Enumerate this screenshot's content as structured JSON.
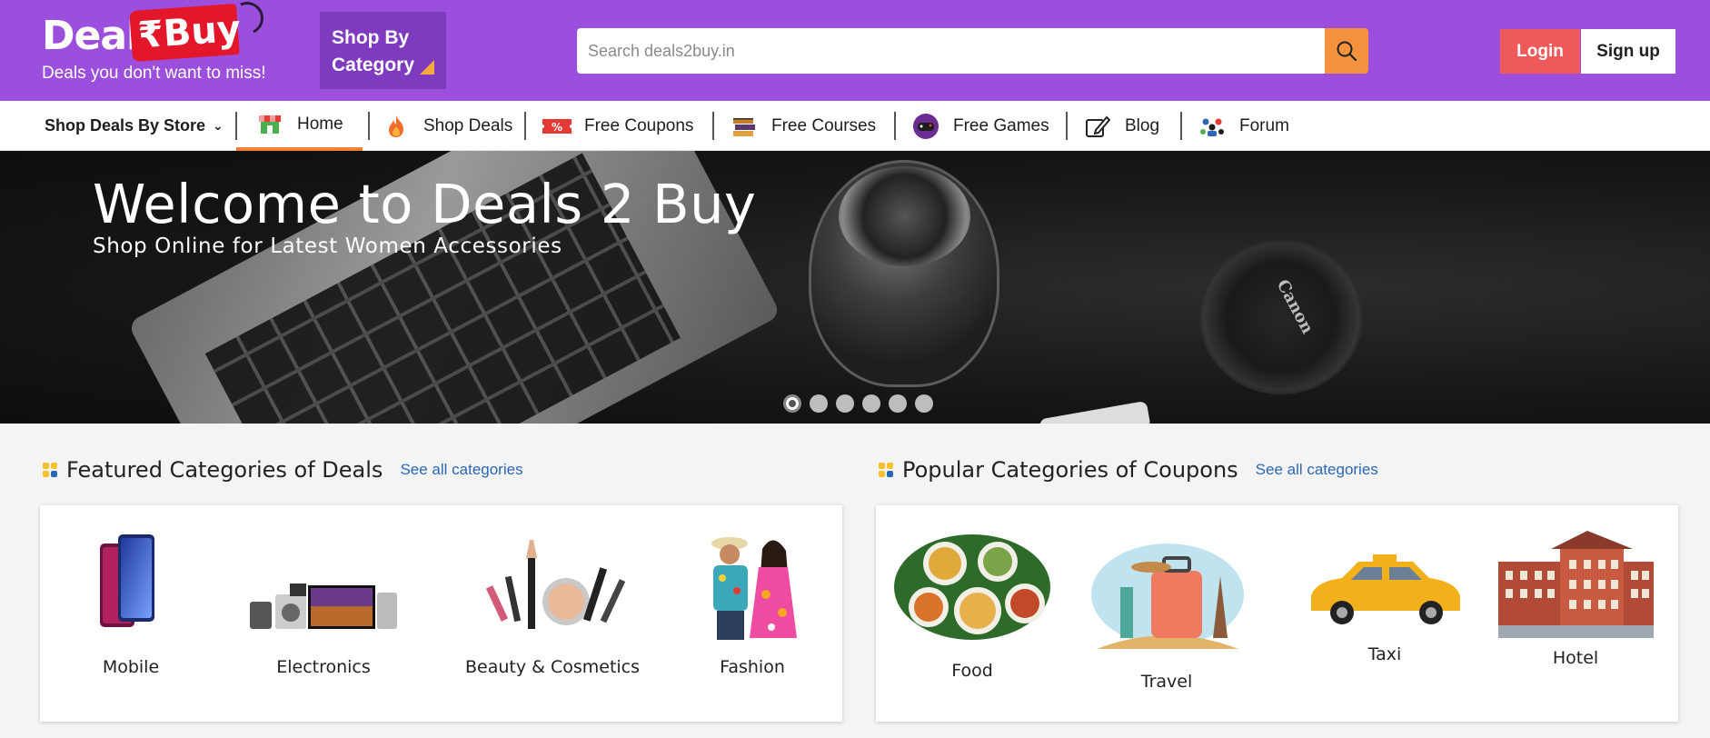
{
  "header": {
    "logo_word": "Deals",
    "logo_tag": "₹Buy",
    "tagline": "Deals you don't want to miss!",
    "category_button": [
      "Shop By",
      "Category"
    ],
    "search": {
      "placeholder": "Search deals2buy.in",
      "value": ""
    },
    "login_label": "Login",
    "signup_label": "Sign up"
  },
  "nav": {
    "store_label": "Shop Deals By Store",
    "items": [
      {
        "label": "Home",
        "icon": "store-icon"
      },
      {
        "label": "Shop Deals",
        "icon": "flame-icon"
      },
      {
        "label": "Free Coupons",
        "icon": "coupon-icon"
      },
      {
        "label": "Free Courses",
        "icon": "books-icon"
      },
      {
        "label": "Free Games",
        "icon": "gamepad-icon"
      },
      {
        "label": "Blog",
        "icon": "pen-icon"
      },
      {
        "label": "Forum",
        "icon": "people-icon"
      }
    ]
  },
  "hero": {
    "title": "Welcome to Deals 2 Buy",
    "subtitle": "Shop Online for Latest Women Accessories",
    "lens_brand": "Canon",
    "slide_count": 6,
    "active_slide": 1
  },
  "featured": {
    "title": "Featured Categories of Deals",
    "link": "See all categories",
    "items": [
      {
        "label": "Mobile"
      },
      {
        "label": "Electronics"
      },
      {
        "label": "Beauty & Cosmetics"
      },
      {
        "label": "Fashion"
      }
    ]
  },
  "popular": {
    "title": "Popular Categories of Coupons",
    "link": "See all categories",
    "items": [
      {
        "label": "Food"
      },
      {
        "label": "Travel"
      },
      {
        "label": "Taxi"
      },
      {
        "label": "Hotel"
      }
    ]
  },
  "colors": {
    "header_purple": "#9b4fdc",
    "category_purple": "#7f3bbf",
    "search_orange": "#f5923e",
    "login_red": "#ee5a5a",
    "link_blue": "#2a67b8",
    "home_underline": "#f07f3a"
  }
}
